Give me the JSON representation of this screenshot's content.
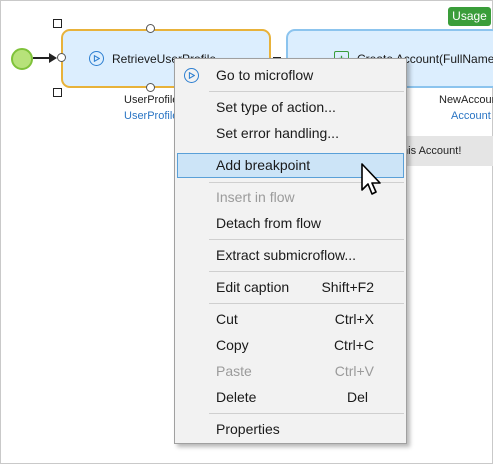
{
  "canvas": {
    "usage_badge": "Usage",
    "activity1": {
      "label": "RetrieveUserProfile",
      "output_variable": "UserProfile",
      "output_type": "UserProfile"
    },
    "activity2": {
      "label": "Create Account(FullName",
      "output_variable": "NewAccount",
      "output_type": "Account"
    },
    "annotation_text": "this Account!"
  },
  "context_menu": {
    "items": [
      {
        "label": "Go to microflow",
        "shortcut": "",
        "icon": "microflow-play-icon",
        "disabled": false
      },
      {
        "label": "Set type of action...",
        "shortcut": "",
        "disabled": false
      },
      {
        "label": "Set error handling...",
        "shortcut": "",
        "disabled": false
      },
      {
        "label": "Add breakpoint",
        "shortcut": "",
        "disabled": false,
        "highlighted": true
      },
      {
        "label": "Insert in flow",
        "shortcut": "",
        "disabled": true
      },
      {
        "label": "Detach from flow",
        "shortcut": "",
        "disabled": false
      },
      {
        "label": "Extract submicroflow...",
        "shortcut": "",
        "disabled": false
      },
      {
        "label": "Edit caption",
        "shortcut": "Shift+F2",
        "disabled": false
      },
      {
        "label": "Cut",
        "shortcut": "Ctrl+X",
        "disabled": false
      },
      {
        "label": "Copy",
        "shortcut": "Ctrl+C",
        "disabled": false
      },
      {
        "label": "Paste",
        "shortcut": "Ctrl+V",
        "disabled": true
      },
      {
        "label": "Delete",
        "shortcut": "Del",
        "disabled": false
      },
      {
        "label": "Properties",
        "shortcut": "",
        "disabled": false
      }
    ]
  },
  "colors": {
    "selected_activity_border": "#e8b23a",
    "activity_fill": "#dceefe",
    "usage_badge": "#3a9d3a",
    "start_event": "#b7e27a",
    "menu_highlight": "#cce4f7"
  }
}
